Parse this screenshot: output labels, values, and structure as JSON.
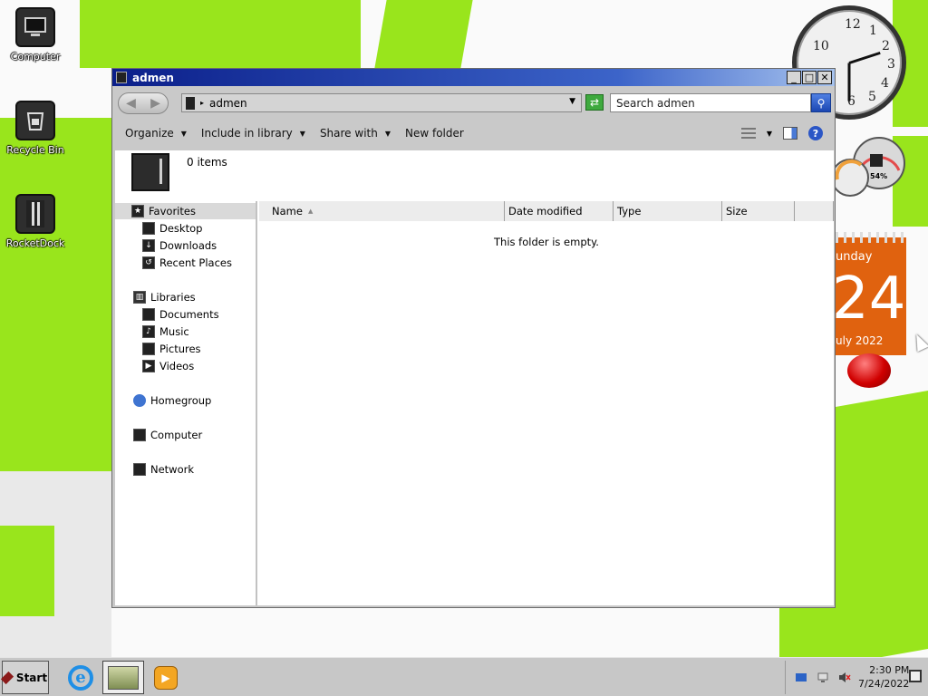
{
  "desktop": {
    "icons": [
      {
        "label": "Computer",
        "icon": "computer-icon"
      },
      {
        "label": "Recycle Bin",
        "icon": "recycle-bin-icon"
      },
      {
        "label": "RocketDock",
        "icon": "rocketdock-icon"
      }
    ],
    "gadgets": {
      "clock_numbers": [
        "12",
        "1",
        "2",
        "3",
        "4",
        "5",
        "6",
        "10"
      ],
      "meter_label": "54%",
      "calendar_day": "unday",
      "calendar_date": "24",
      "calendar_month": "uly 2022"
    }
  },
  "window": {
    "title": "admen",
    "buttons": {
      "minimize": "_",
      "maximize": "□",
      "close": "✕"
    },
    "address": {
      "path": "admen"
    },
    "search": {
      "placeholder": "Search admen"
    },
    "toolbar": {
      "organize": "Organize",
      "include_in_library": "Include in library",
      "share_with": "Share with",
      "new_folder": "New folder"
    },
    "info": {
      "items": "0 items"
    },
    "nav": {
      "favorites": "Favorites",
      "desktop": "Desktop",
      "downloads": "Downloads",
      "recent_places": "Recent Places",
      "libraries": "Libraries",
      "documents": "Documents",
      "music": "Music",
      "pictures": "Pictures",
      "videos": "Videos",
      "homegroup": "Homegroup",
      "computer": "Computer",
      "network": "Network"
    },
    "columns": [
      "Name",
      "Date modified",
      "Type",
      "Size"
    ],
    "empty_message": "This folder is empty."
  },
  "taskbar": {
    "start": "Start",
    "apps": [
      "internet-explorer-icon",
      "windows-explorer-icon",
      "media-player-icon"
    ],
    "time": "2:30 PM",
    "date": "7/24/2022"
  },
  "colors": {
    "wallpaper_green": "#99e51c",
    "titlebar_blue": "#0b1f8a",
    "calendar_orange": "#e0620f"
  }
}
